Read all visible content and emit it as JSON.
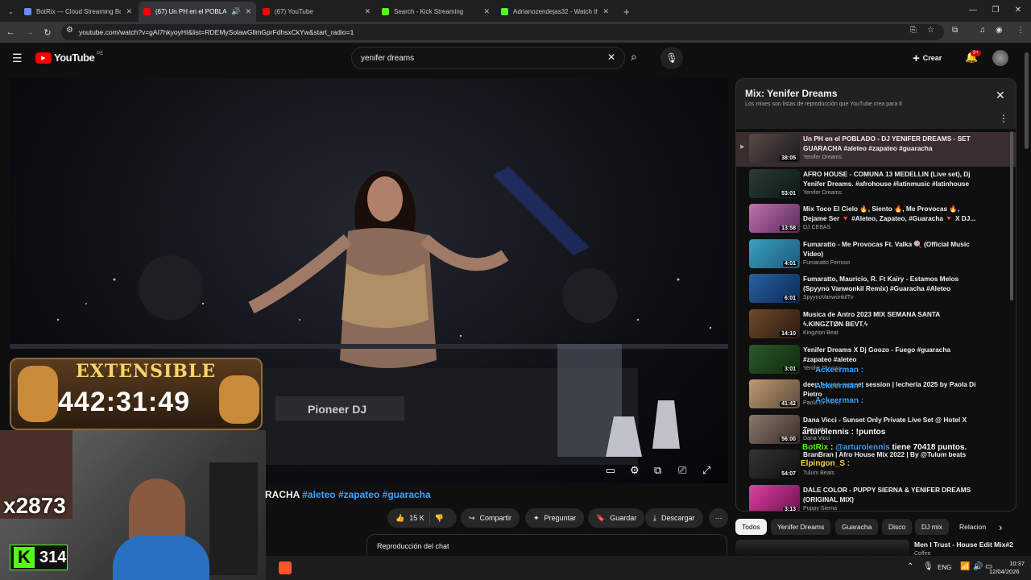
{
  "browser": {
    "tabs": [
      {
        "title": "BotRix — Cloud Streaming Bot",
        "color": "#6b8cff"
      },
      {
        "title": "(67) Un PH en el POBLADO",
        "color": "#ff0000"
      },
      {
        "title": "(67) YouTube",
        "color": "#ff0000"
      },
      {
        "title": "Search - Kick Streaming",
        "color": "#53fc18"
      },
      {
        "title": "Adrianozendejas32 - Watch the",
        "color": "#53fc18"
      }
    ],
    "url": "youtube.com/watch?v=gAI7hkyoyHI&list=RDEMySolawGllmGprFdhsxCkYw&start_radio=1"
  },
  "youtube": {
    "logo": "YouTube",
    "region": "PE",
    "search_value": "yenifer dreams",
    "create_label": "Crear",
    "notif_count": "9+"
  },
  "overlay": {
    "extensible_label": "EXTENSIBLE",
    "timer": "442:31:49",
    "multiplier": "x2873",
    "kick_points": "314"
  },
  "video": {
    "title_prefix": "RACHA",
    "tags": [
      "#aleteo",
      "#zapateo",
      "#guaracha"
    ],
    "likes": "15 K",
    "share": "Compartir",
    "ask": "Preguntar",
    "save": "Guardar",
    "download": "Descargar",
    "chat_replay": "Reproducción del chat"
  },
  "mix": {
    "title": "Mix: Yenifer Dreams",
    "subtitle": "Los mixes son listas de reproducción que YouTube crea para ti",
    "items": [
      {
        "title": "Un PH en el POBLADO - DJ YENIFER DREAMS - SET GUARACHA #aleteo #zapateo #guaracha",
        "author": "Yenifer Dreams",
        "duration": "38:05"
      },
      {
        "title": "AFRO HOUSE - COMUNA 13 MEDELLIN (Live set), Dj Yenifer Dreams. #afrohouse #latinmusic #latinhouse",
        "author": "Yenifer Dreams",
        "duration": "53:01"
      },
      {
        "title": "Mix Toco El Cielo 🔥, Siento 🔥, Me Provocas 🔥, Dejame Ser 🔻 #Aleteo, Zapateo, #Guaracha 🔻 X DJ...",
        "author": "DJ CEBAS",
        "duration": "13:58"
      },
      {
        "title": "Fumaratto - Me Provocas Ft. Valka 🍭 (Official Music Video)",
        "author": "Fumaratto Ferroso",
        "duration": "4:01"
      },
      {
        "title": "Fumaratto, Mauricio, R. Ft Kairy - Estamos Melos (Spyyno Vanwonkil Remix) #Guaracha #Aleteo",
        "author": "SpyynoVanwonkilTv",
        "duration": "6:01"
      },
      {
        "title": "Musica de Antro 2023 MIX SEMANA SANTA ϟ.KINGZTØN BEVT.ϟ",
        "author": "Kingzton Beat",
        "duration": "14:10"
      },
      {
        "title": "Yenifer Dreams X Dj Goozo - Fuego #guaracha #zapateo #aleteo",
        "author": "Yenifer Dreams",
        "duration": "3:01"
      },
      {
        "title": "deep house sunset session | lecheria 2025 by Paola Di Pietro",
        "author": "Paola Di Pietro",
        "duration": "41:42"
      },
      {
        "title": "Dana Vicci - Sunset Only Private Live Set @ Hotel X Toronto",
        "author": "Dana Vicci",
        "duration": "56:00"
      },
      {
        "title": "BranBran | Afro House Mix 2022 | By @Tulum beats",
        "author": "Tulum Beats",
        "duration": "54:07"
      },
      {
        "title": "DALE COLOR - PUPPY SIERNA & YENIFER DREAMS (ORIGINAL MIX)",
        "author": "Puppy Sierna",
        "duration": "3:13"
      }
    ]
  },
  "chips": [
    "Todos",
    "Yenifer Dreams",
    "Guaracha",
    "Disco",
    "DJ mix",
    "Relacion"
  ],
  "next_video": {
    "title": "Men I Trust - House Edit Mix#2",
    "author": "Coffee"
  },
  "chat": [
    {
      "text": "Ackeerman :",
      "color": "#3ea6ff"
    },
    {
      "text": "Ackeerman :",
      "color": "#3ea6ff"
    },
    {
      "text": "Ackeerman :",
      "color": "#3ea6ff"
    },
    {
      "text": "arturolennis : !puntos",
      "color": "#ffffff"
    },
    {
      "user": "BotRix",
      "mention": "@arturolennis",
      "msg": "tiene 70418 puntos.",
      "color": "#53fc18"
    },
    {
      "text": "Elpingon_S :",
      "color": "#ffd54f"
    }
  ],
  "system": {
    "lang": "ENG",
    "time": "10:37",
    "date": "12/04/2026"
  }
}
